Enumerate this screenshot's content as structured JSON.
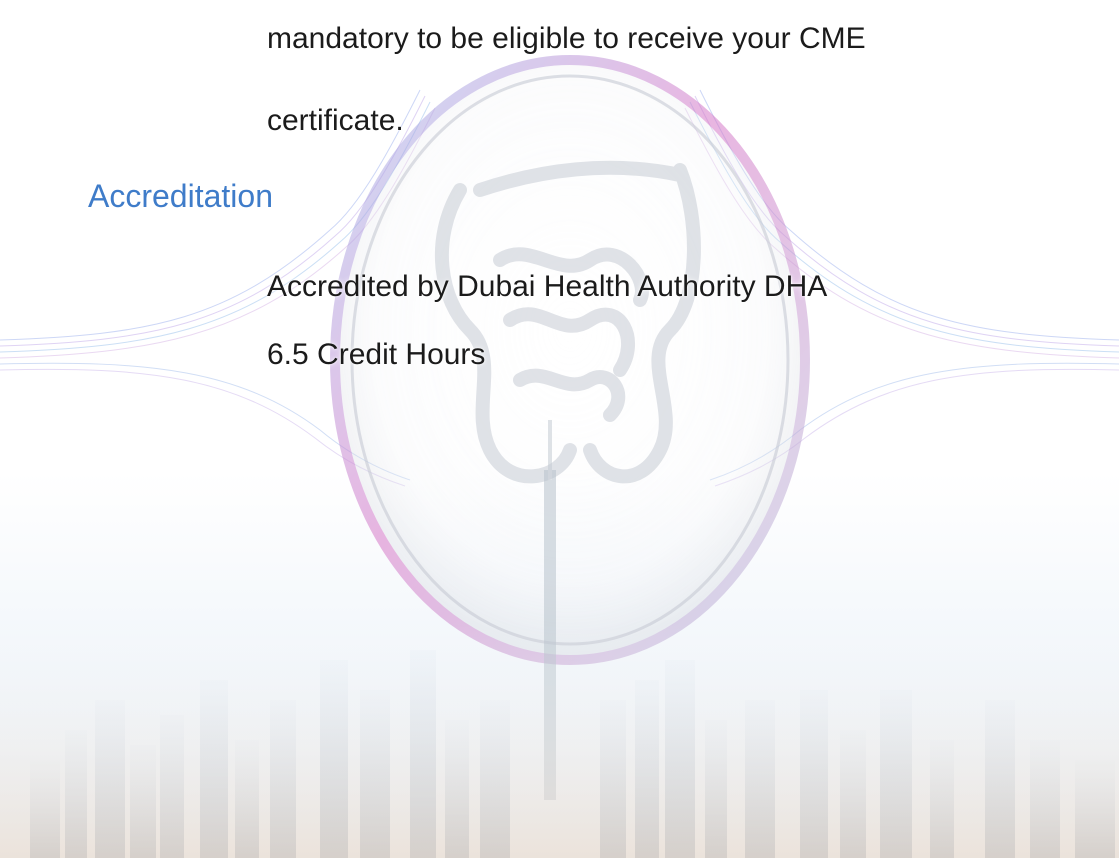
{
  "document": {
    "intro_line_1": "mandatory to be eligible to receive your CME",
    "intro_line_2": "certificate.",
    "section_heading": "Accreditation",
    "accreditation_body": "Accredited by Dubai Health Authority DHA",
    "credit_hours": "6.5 Credit Hours"
  },
  "colors": {
    "heading": "#3f7cc9",
    "body_text": "#1b1b1b",
    "ring_pink": "#d774c8",
    "ring_blue": "#8fb7e8"
  }
}
